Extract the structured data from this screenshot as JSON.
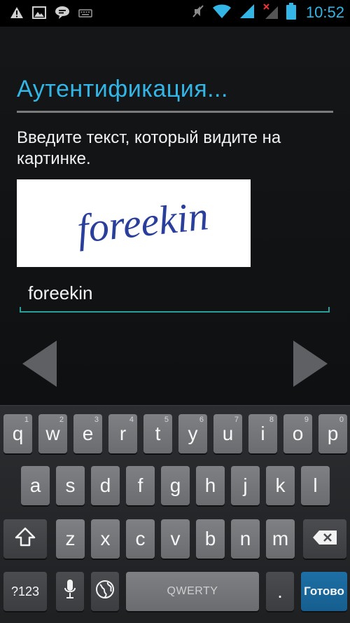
{
  "status_bar": {
    "time": "10:52",
    "left_icons": [
      "warning-icon",
      "image-icon",
      "chat-icon",
      "keyboard-icon"
    ],
    "right_icons": [
      "mute-icon",
      "wifi-icon",
      "signal-icon",
      "signal-no-service-icon",
      "battery-icon"
    ],
    "accent_color": "#33b5e5"
  },
  "auth": {
    "title": "Аутентификация...",
    "prompt": "Введите текст, который видите на картинке.",
    "captcha_text": "foreekin",
    "answer_value": "foreekin"
  },
  "keyboard": {
    "row1": [
      {
        "key": "q",
        "hint": "1"
      },
      {
        "key": "w",
        "hint": "2"
      },
      {
        "key": "e",
        "hint": "3"
      },
      {
        "key": "r",
        "hint": "4"
      },
      {
        "key": "t",
        "hint": "5"
      },
      {
        "key": "y",
        "hint": "6"
      },
      {
        "key": "u",
        "hint": "7"
      },
      {
        "key": "i",
        "hint": "8"
      },
      {
        "key": "o",
        "hint": "9"
      },
      {
        "key": "p",
        "hint": "0"
      }
    ],
    "row2": [
      "a",
      "s",
      "d",
      "f",
      "g",
      "h",
      "j",
      "k",
      "l"
    ],
    "row3": [
      "z",
      "x",
      "c",
      "v",
      "b",
      "n",
      "m"
    ],
    "symbols_label": "?123",
    "space_label": "QWERTY",
    "period_label": ".",
    "done_label": "Готово",
    "done_color": "#1d6fa5"
  }
}
